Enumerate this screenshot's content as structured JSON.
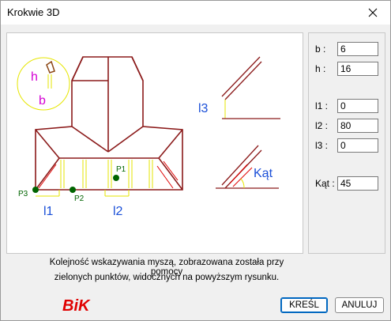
{
  "window": {
    "title": "Krokwie 3D"
  },
  "fields": [
    {
      "label": "b :",
      "value": "6"
    },
    {
      "label": "h :",
      "value": "16"
    },
    {
      "label": "l1 :",
      "value": "0"
    },
    {
      "label": "l2 :",
      "value": "80"
    },
    {
      "label": "l3 :",
      "value": "0"
    },
    {
      "label": "Kąt :",
      "value": "45"
    }
  ],
  "drawing": {
    "h_label": "h",
    "b_label": "b",
    "l3_label": "l3",
    "kat_label": "Kąt",
    "p1_label": "P1",
    "p2_label": "P2",
    "p3_label": "P3",
    "l1_label": "l1",
    "l2_label": "l2",
    "colors": {
      "roof": "#8b1a1a",
      "hatch": "#e00000",
      "dimension": "#e6e600",
      "text_blue": "#1a4fd8",
      "text_magenta": "#d400d4",
      "points": "#006400"
    }
  },
  "info": {
    "line1": "Kolejność wskazywania myszą, zobrazowana została przy pomocy",
    "line2": "zielonych punktów, widocznych na powyższym rysunku."
  },
  "logo": {
    "text": "BiK",
    "color": "#e00000"
  },
  "buttons": {
    "ok": "KREŚL",
    "cancel": "ANULUJ"
  }
}
